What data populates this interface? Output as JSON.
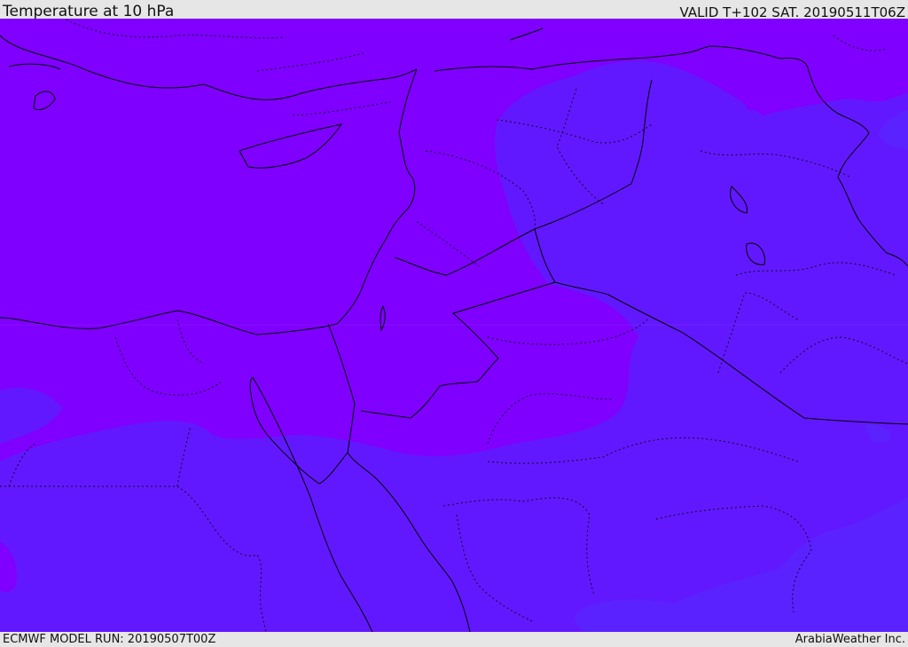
{
  "header": {
    "title": "Temperature at 10 hPa",
    "valid": "VALID T+102 SAT. 20190511T06Z"
  },
  "footer": {
    "model_run": "ECMWF MODEL RUN: 20190507T00Z",
    "credit": "ArabiaWeather Inc."
  },
  "colors": {
    "warm_field": "#7f00ff",
    "cool_field": "#6218ff",
    "cooler_field": "#5a22ff",
    "boundaries": "#000000"
  }
}
